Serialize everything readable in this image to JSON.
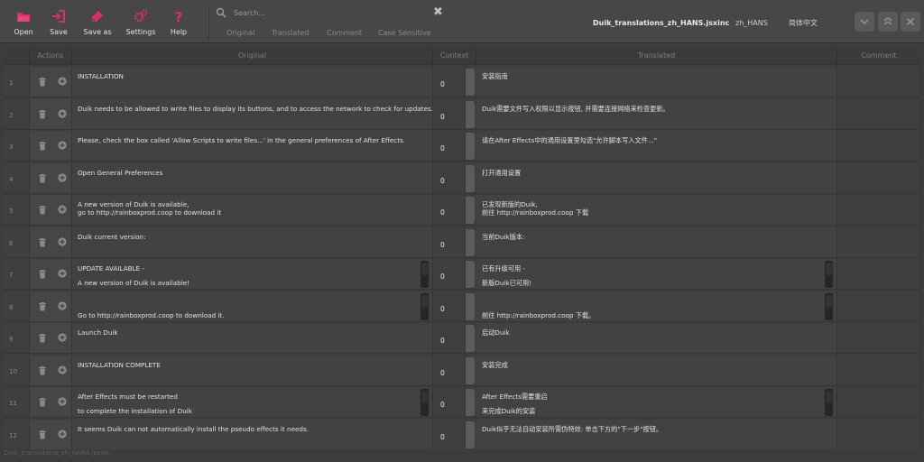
{
  "toolbar": {
    "buttons": [
      {
        "label": "Open",
        "icon": "folder-open-icon",
        "color": "#d8316a"
      },
      {
        "label": "Save",
        "icon": "save-icon",
        "color": "#d8316a"
      },
      {
        "label": "Save as",
        "icon": "save-as-icon",
        "color": "#d8316a"
      },
      {
        "label": "Settings",
        "icon": "gear-icon",
        "color": "#d8316a"
      },
      {
        "label": "Help",
        "icon": "help-icon",
        "color": "#d8316a"
      }
    ]
  },
  "search": {
    "placeholder": "Search...",
    "clear_icon": "close-icon",
    "filters": [
      "Original",
      "Translated",
      "Comment",
      "Case Sensitive"
    ]
  },
  "file": {
    "title": "Duik_translations_zh_HANS.jsxinc",
    "language_code": "zh_HANS",
    "language_name": "简体中文"
  },
  "window_buttons": [
    "minimize-icon",
    "maximize-icon",
    "close-icon"
  ],
  "table": {
    "headers": {
      "actions": "Actions",
      "original": "Original",
      "context": "Context",
      "translated": "Translated",
      "comment": "Comment"
    },
    "rows": [
      {
        "num": "1",
        "original": [
          "INSTALLATION"
        ],
        "context": "0",
        "translated": [
          "安装指南"
        ],
        "scroll": false
      },
      {
        "num": "2",
        "original": [
          "Duik needs to be allowed to write files to display its buttons, and to access the network to check for updates."
        ],
        "context": "0",
        "translated": [
          "Duik需要文件写入权限以显示按钮, 并需要连接网络来检查更新。"
        ],
        "scroll": false
      },
      {
        "num": "3",
        "original": [
          "Please, check the box called 'Allow Scripts to write files...' in the general preferences of After Effects."
        ],
        "context": "0",
        "translated": [
          "请在After Effects中的通用设置里勾选\"允许脚本写入文件...\""
        ],
        "scroll": false
      },
      {
        "num": "4",
        "original": [
          "Open General Preferences"
        ],
        "context": "0",
        "translated": [
          "打开通用设置"
        ],
        "scroll": false
      },
      {
        "num": "5",
        "original": [
          "A new version of Duik is available,",
          "go to http://rainboxprod.coop to download it"
        ],
        "context": "0",
        "translated": [
          "已发现新版的Duik,",
          "前往 http://rainboxprod.coop 下载"
        ],
        "scroll": false
      },
      {
        "num": "6",
        "original": [
          "Duik current version:"
        ],
        "context": "0",
        "translated": [
          "当前Duik版本:"
        ],
        "scroll": false
      },
      {
        "num": "7",
        "original": [
          "UPDATE AVAILABLE -",
          "A new version of Duik is available!"
        ],
        "context": "0",
        "translated": [
          "已有升级可用 -",
          "新版Duik已可用!"
        ],
        "scroll": true,
        "gap": true
      },
      {
        "num": "8",
        "original": [
          "",
          "Go to http://rainboxprod.coop to download it."
        ],
        "context": "0",
        "translated": [
          "",
          "前往 http://rainboxprod.coop 下载。"
        ],
        "scroll": true,
        "gap": true
      },
      {
        "num": "9",
        "original": [
          "Launch Duik"
        ],
        "context": "0",
        "translated": [
          "启动Duik"
        ],
        "scroll": false
      },
      {
        "num": "10",
        "original": [
          "INSTALLATION COMPLETE"
        ],
        "context": "0",
        "translated": [
          "安装完成"
        ],
        "scroll": false
      },
      {
        "num": "11",
        "original": [
          "After Effects must be restarted",
          "to complete the installation of Duik"
        ],
        "context": "0",
        "translated": [
          "After Effects需要重启",
          "来完成Duik的安装"
        ],
        "scroll": true,
        "gap": true
      },
      {
        "num": "12",
        "original": [
          "It seems Duik can not automatically install the pseudo effects it needs."
        ],
        "context": "0",
        "translated": [
          "Duik似乎无法自动安装所需伪特效: 单击下方的\"下一步\"按钮。"
        ],
        "scroll": false
      }
    ]
  },
  "footer": {
    "path": "Duik_translations_zh_HANS.jsxinc"
  },
  "colors": {
    "accent": "#d8316a",
    "background": "#3c3c3c",
    "toolbar": "#474747"
  }
}
